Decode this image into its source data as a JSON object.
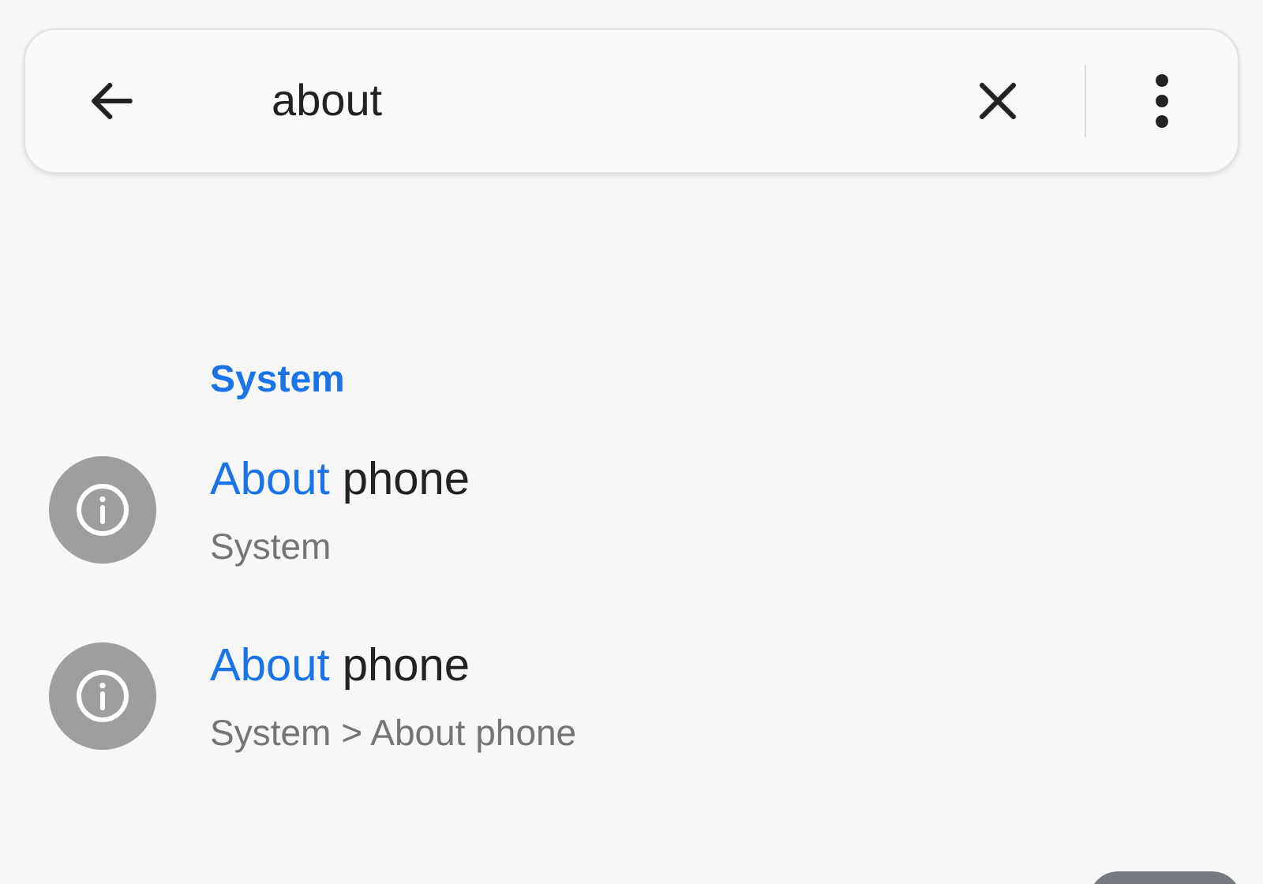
{
  "search": {
    "value": "about"
  },
  "section": {
    "title": "System"
  },
  "results": [
    {
      "match": "About",
      "title_rest": " phone",
      "path": "System"
    },
    {
      "match": "About",
      "title_rest": " phone",
      "path": "System > About phone"
    }
  ]
}
